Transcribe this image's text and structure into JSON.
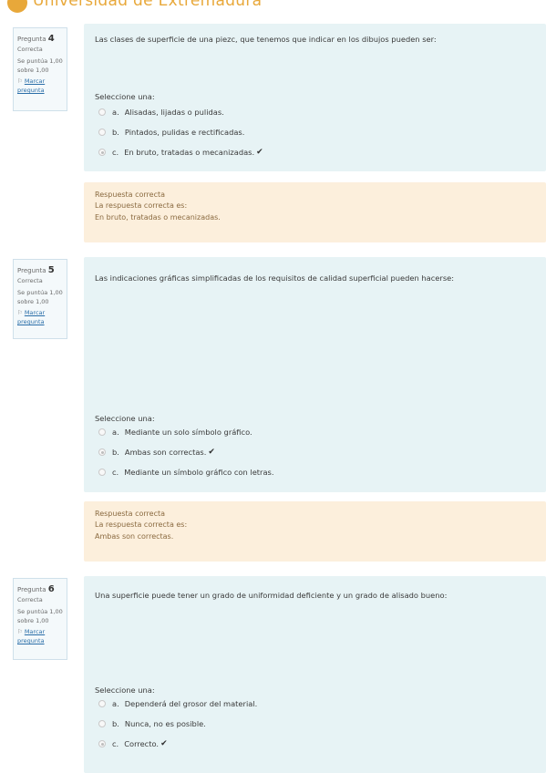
{
  "site": {
    "name": "Universidad de Extremadura"
  },
  "questions": [
    {
      "label": "Pregunta",
      "number": "4",
      "status": "Correcta",
      "score_line1": "Se puntúa 1,00",
      "score_line2": "sobre 1,00",
      "flag_line1": "Marcar",
      "flag_line2": "pregunta",
      "text": "Las clases de superficie de una piezc, que tenemos que indicar en los dibujos pueden ser:",
      "prompt": "Seleccione una:",
      "answers": [
        {
          "letter": "a.",
          "text": "Alisadas, lijadas o pulidas.",
          "selected": false,
          "correct": false
        },
        {
          "letter": "b.",
          "text": "Pintados, pulidas e rectificadas.",
          "selected": false,
          "correct": false
        },
        {
          "letter": "c.",
          "text": "En bruto, tratadas o mecanizadas.",
          "selected": true,
          "correct": true
        }
      ],
      "feedback_title": "Respuesta correcta",
      "feedback_label": "La respuesta correcta es:",
      "feedback_answer": "En bruto, tratadas o mecanizadas."
    },
    {
      "label": "Pregunta",
      "number": "5",
      "status": "Correcta",
      "score_line1": "Se puntúa 1,00",
      "score_line2": "sobre 1,00",
      "flag_line1": "Marcar",
      "flag_line2": "pregunta",
      "text": "Las indicaciones gráficas simplificadas de los requisitos de calidad superficial pueden hacerse:",
      "prompt": "Seleccione una:",
      "answers": [
        {
          "letter": "a.",
          "text": "Mediante un solo símbolo gráfico.",
          "selected": false,
          "correct": false
        },
        {
          "letter": "b.",
          "text": "Ambas son correctas.",
          "selected": true,
          "correct": true
        },
        {
          "letter": "c.",
          "text": "Mediante un símbolo gráfico con letras.",
          "selected": false,
          "correct": false
        }
      ],
      "feedback_title": "Respuesta correcta",
      "feedback_label": "La respuesta correcta es:",
      "feedback_answer": "Ambas son correctas."
    },
    {
      "label": "Pregunta",
      "number": "6",
      "status": "Correcta",
      "score_line1": "Se puntúa 1,00",
      "score_line2": "sobre 1,00",
      "flag_line1": "Marcar",
      "flag_line2": "pregunta",
      "text": "Una superficie puede tener un grado de uniformidad deficiente y un grado de alisado bueno:",
      "prompt": "Seleccione una:",
      "answers": [
        {
          "letter": "a.",
          "text": "Dependerá del grosor del material.",
          "selected": false,
          "correct": false
        },
        {
          "letter": "b.",
          "text": "Nunca, no es posible.",
          "selected": false,
          "correct": false
        },
        {
          "letter": "c.",
          "text": "Correcto.",
          "selected": true,
          "correct": true
        }
      ]
    }
  ],
  "icons": {
    "flag": "flag-icon",
    "check": "check-icon",
    "logo": "university-logo-icon"
  },
  "colors": {
    "question_bg": "#e7f3f5",
    "feedback_bg": "#fcefdc",
    "brand": "#e8a83a"
  }
}
